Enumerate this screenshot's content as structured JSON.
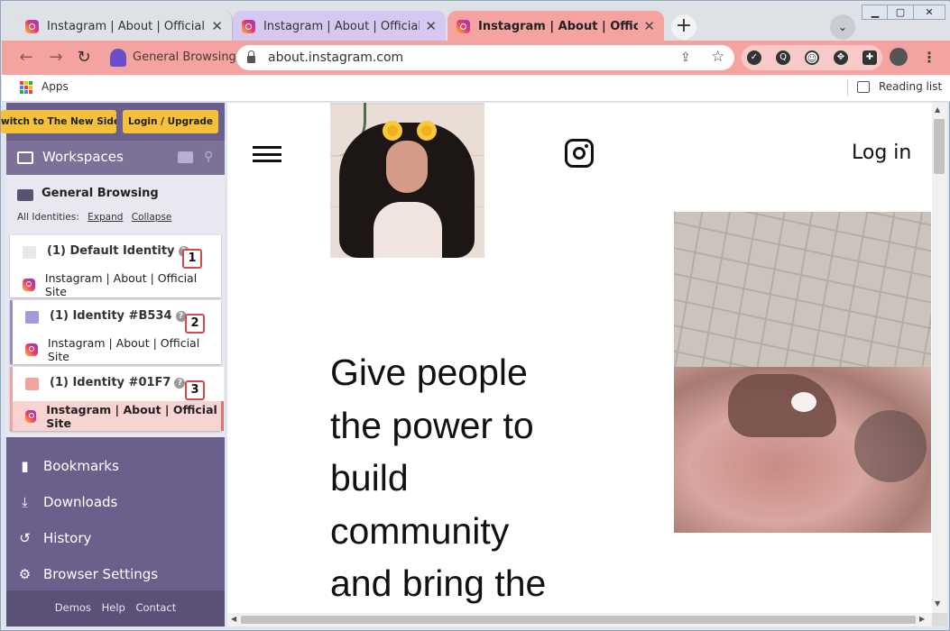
{
  "tabs": [
    {
      "title": "Instagram | About | Official Site",
      "close": "✕"
    },
    {
      "title": "Instagram | About | Official Site",
      "close": "✕"
    },
    {
      "title": "Instagram | About | Official Site",
      "close": "✕"
    }
  ],
  "new_tab": "+",
  "window_controls": {
    "minimize": "▁",
    "maximize": "▢",
    "close": "✕"
  },
  "toolbar": {
    "back": "←",
    "forward": "→",
    "reload": "↻",
    "profile_label": "General Browsing",
    "url": "about.instagram.com",
    "menu": "⋮"
  },
  "bookmarks": {
    "apps_label": "Apps",
    "reading_list": "Reading list"
  },
  "sidebar": {
    "switch_button": "witch to The New Sidebar",
    "login_button": "Login / Upgrade",
    "workspaces_title": "Workspaces",
    "group_title": "General Browsing",
    "all_identities": "All Identities:",
    "expand": "Expand",
    "collapse": "Collapse",
    "identities": [
      {
        "label": "(1) Default Identity",
        "number": "1",
        "site": "Instagram | About | Official Site"
      },
      {
        "label": "(1) Identity #B534",
        "number": "2",
        "site": "Instagram | About | Official Site"
      },
      {
        "label": "(1) Identity #01F7",
        "number": "3",
        "site": "Instagram | About | Official Site"
      }
    ],
    "nav": {
      "bookmarks": "Bookmarks",
      "downloads": "Downloads",
      "history": "History",
      "settings": "Browser Settings"
    },
    "footer": {
      "demos": "Demos",
      "help": "Help",
      "contact": "Contact"
    }
  },
  "page": {
    "login": "Log in",
    "headline": [
      "Give people",
      "the power to",
      "build",
      "community",
      "and bring the"
    ]
  },
  "colors": {
    "active_tab": "#f4a3a0",
    "second_tab": "#d6c8f0",
    "sidebar": "#6b5f8b",
    "login_yellow": "#f5c13a",
    "badge_border": "#d34a4a"
  }
}
